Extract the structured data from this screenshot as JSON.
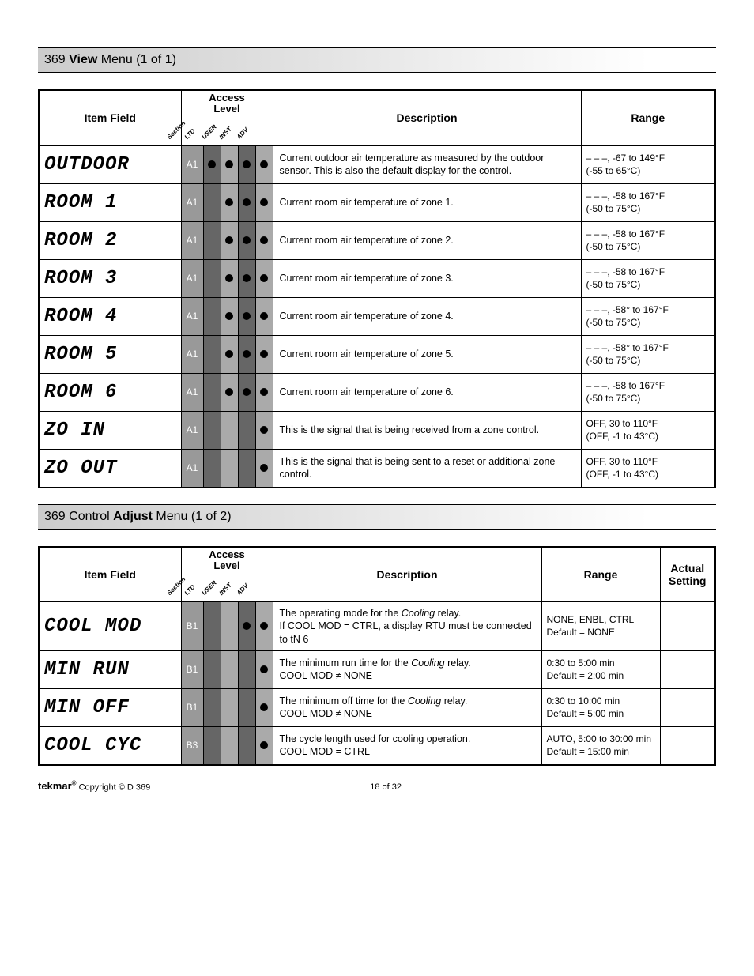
{
  "viewMenu": {
    "title_prefix": "369 ",
    "title_bold": "View",
    "title_suffix": " Menu (1 of 1)",
    "headers": {
      "item": "Item Field",
      "access": "Access\nLevel",
      "desc": "Description",
      "range": "Range",
      "levels": [
        "Section",
        "LTD",
        "USER",
        "INST",
        "ADV"
      ]
    },
    "rows": [
      {
        "seg": "OUTDOOR",
        "section": "A1",
        "dots": [
          true,
          true,
          true,
          true
        ],
        "desc": "Current outdoor air temperature as measured by the outdoor sensor. This is also the default display for the control.",
        "range": "– – –, -67 to 149°F\n(-55 to 65°C)"
      },
      {
        "seg": "ROOM  1",
        "section": "A1",
        "dots": [
          false,
          true,
          true,
          true
        ],
        "desc": "Current room air temperature of zone 1.",
        "range": "– – –, -58 to 167°F\n(-50 to 75°C)"
      },
      {
        "seg": "ROOM  2",
        "section": "A1",
        "dots": [
          false,
          true,
          true,
          true
        ],
        "desc": "Current room air temperature of zone 2.",
        "range": "– – –, -58 to 167°F\n(-50 to 75°C)"
      },
      {
        "seg": "ROOM  3",
        "section": "A1",
        "dots": [
          false,
          true,
          true,
          true
        ],
        "desc": "Current room air temperature of zone 3.",
        "range": "– – –, -58 to 167°F\n(-50 to 75°C)"
      },
      {
        "seg": "ROOM  4",
        "section": "A1",
        "dots": [
          false,
          true,
          true,
          true
        ],
        "desc": "Current room air temperature of zone 4.",
        "range": "– – –, -58° to 167°F\n(-50 to 75°C)"
      },
      {
        "seg": "ROOM  5",
        "section": "A1",
        "dots": [
          false,
          true,
          true,
          true
        ],
        "desc": "Current room air temperature of zone 5.",
        "range": "– – –, -58° to 167°F\n(-50 to 75°C)"
      },
      {
        "seg": "ROOM  6",
        "section": "A1",
        "dots": [
          false,
          true,
          true,
          true
        ],
        "desc": "Current room air temperature of zone 6.",
        "range": "– – –, -58 to 167°F\n(-50 to 75°C)"
      },
      {
        "seg": "ZO  IN",
        "section": "A1",
        "dots": [
          false,
          false,
          false,
          true
        ],
        "desc": "This is the signal that is being received from a zone control.",
        "range": "OFF, 30 to 110°F\n(OFF, -1 to 43°C)"
      },
      {
        "seg": "ZO  OUT",
        "section": "A1",
        "dots": [
          false,
          false,
          false,
          true
        ],
        "desc": "This is the signal that is being sent to a reset or additional zone control.",
        "range": "OFF, 30 to 110°F\n(OFF, -1 to 43°C)"
      }
    ]
  },
  "adjustMenu": {
    "title_prefix": "369 Control ",
    "title_bold": "Adjust",
    "title_suffix": " Menu (1 of 2)",
    "headers": {
      "item": "Item Field",
      "access": "Access\nLevel",
      "desc": "Description",
      "range": "Range",
      "actual": "Actual Setting",
      "levels": [
        "Section",
        "LTD",
        "USER",
        "INST",
        "ADV"
      ]
    },
    "rows": [
      {
        "seg": "COOL MOD",
        "section": "B1",
        "dots": [
          false,
          false,
          true,
          true
        ],
        "desc": "The operating mode for the <i>Cooling</i> relay.<br>If COOL MOD = CTRL, a display RTU must be connected to tN 6",
        "range": "NONE, ENBL, CTRL<br>Default = NONE"
      },
      {
        "seg": "MIN RUN",
        "section": "B1",
        "dots": [
          false,
          false,
          false,
          true
        ],
        "desc": "The minimum run time for the <i>Cooling</i> relay.<br>COOL MOD ≠ NONE",
        "range": "0:30 to 5:00 min<br>Default = 2:00 min"
      },
      {
        "seg": "MIN OFF",
        "section": "B1",
        "dots": [
          false,
          false,
          false,
          true
        ],
        "desc": "The minimum off time for the <i>Cooling</i> relay.<br>COOL MOD ≠ NONE",
        "range": "0:30 to 10:00 min<br>Default = 5:00 min"
      },
      {
        "seg": "COOL CYC",
        "section": "B3",
        "dots": [
          false,
          false,
          false,
          true
        ],
        "desc": "The cycle length used for cooling operation.<br>COOL MOD = CTRL",
        "range": "AUTO, 5:00 to 30:00 min<br>Default = 15:00 min"
      }
    ]
  },
  "footer": {
    "brand": "tekmar",
    "copyright": " Copyright © D 369",
    "page": "18 of 32"
  }
}
